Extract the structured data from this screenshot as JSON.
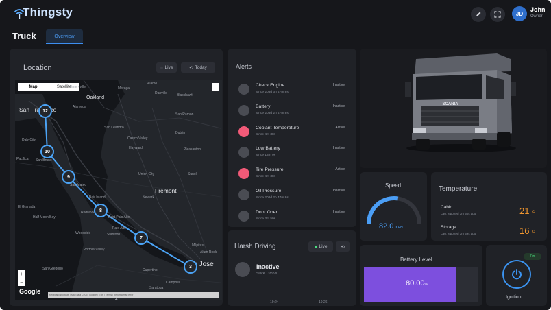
{
  "app": {
    "logo_text": "Thingsty"
  },
  "header": {
    "user_initials": "JD",
    "user_name": "John",
    "user_role": "Owner",
    "edit_icon": "pencil-icon",
    "fullscreen_icon": "expand-icon"
  },
  "page": {
    "title": "Truck",
    "tabs": [
      {
        "label": "Overview",
        "active": true
      }
    ]
  },
  "location": {
    "title": "Location",
    "live_label": "Live",
    "today_label": "Today",
    "map": {
      "type_options": [
        "Map",
        "Satellite"
      ],
      "selected_type": "Map",
      "cities": [
        "San Francisco",
        "Oakland",
        "Fremont",
        "San Jose"
      ],
      "towns": [
        "Emeryville",
        "Moraga",
        "Alamo",
        "Danville",
        "Blackhawk",
        "Alameda",
        "San Ramon",
        "Daly City",
        "San Leandro",
        "Castro Valley",
        "Dublin",
        "Hayward",
        "Pleasanton",
        "Pacifica",
        "San Bruno",
        "Union City",
        "Sunol",
        "San Mateo",
        "Newark",
        "Bair Island",
        "El Granada",
        "Half Moon Bay",
        "Redwood City",
        "East Palo Alto",
        "Palo Alto",
        "Stanford",
        "Woodside",
        "Portola Valley",
        "Milpitas",
        "Cupertino",
        "San Gregorio",
        "Alum Rock",
        "Campbell",
        "Saratoga"
      ],
      "markers": [
        "12",
        "10",
        "9",
        "8",
        "7",
        "3"
      ],
      "zoom_in": "+",
      "zoom_out": "−",
      "provider": "Google",
      "attribution": "Keyboard shortcuts | Map data ©2024 Google | 5 km | Terms | Report a map error"
    }
  },
  "alerts": {
    "title": "Alerts",
    "items": [
      {
        "name": "Check Engine",
        "since": "Since 208d 3h 47m 8s",
        "status": "Inactive",
        "color": "#4a4c53"
      },
      {
        "name": "Battery",
        "since": "Since 208d 2h 47m 8s",
        "status": "Inactive",
        "color": "#4a4c53"
      },
      {
        "name": "Coolant Temperature",
        "since": "Since 4m 38s",
        "status": "Active",
        "color": "#f25a78"
      },
      {
        "name": "Low Battery",
        "since": "Since 13m 9s",
        "status": "Inactive",
        "color": "#4a4c53"
      },
      {
        "name": "Tire Pressure",
        "since": "Since 4m 38s",
        "status": "Active",
        "color": "#f25a78"
      },
      {
        "name": "Oil Pressure",
        "since": "Since 208d 2h 47m 8s",
        "status": "Inactive",
        "color": "#4a4c53"
      },
      {
        "name": "Door Open",
        "since": "Since 3m 50s",
        "status": "Inactive",
        "color": "#4a4c53"
      }
    ]
  },
  "harsh_driving": {
    "title": "Harsh Driving",
    "live_label": "Live",
    "status": "Inactive",
    "since": "Since 13m 9s",
    "axis_ticks": [
      "19:24",
      "19:26"
    ]
  },
  "speed": {
    "label": "Speed",
    "value": "82.0",
    "unit": "KPH",
    "gauge_fraction": 0.55,
    "color": "#4b9ef5"
  },
  "temperature": {
    "title": "Temperature",
    "rows": [
      {
        "label": "Cabin",
        "sub": "Last reported 3m 50s ago",
        "value": "21",
        "unit": "c"
      },
      {
        "label": "Storage",
        "sub": "Last reported 3m 59s ago",
        "value": "16",
        "unit": "c"
      }
    ],
    "color": "#f0962f"
  },
  "battery": {
    "label": "Battery Level",
    "value": "80.00",
    "unit": "%",
    "fraction": 0.8,
    "color": "#7d4fde"
  },
  "ignition": {
    "label": "Ignition",
    "badge": "On",
    "icon": "power-icon",
    "color": "#3b93f0"
  },
  "truck": {
    "brand_text": "SCANIA"
  }
}
